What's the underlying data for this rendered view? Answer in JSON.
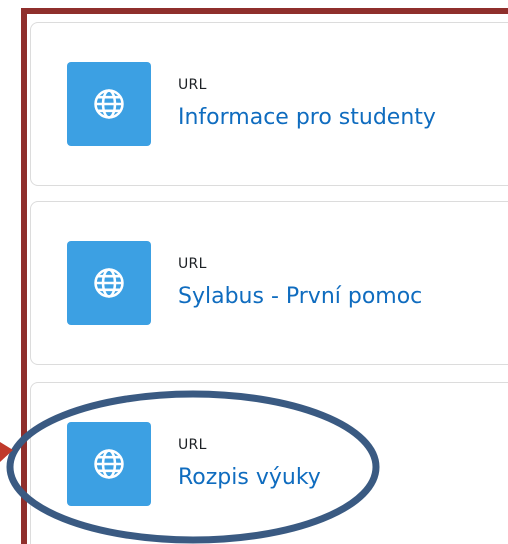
{
  "accent_colors": {
    "frame": "#8f2f2c",
    "icon_tile": "#3ca0e3",
    "link_text": "#0f6cbf",
    "annotation": "#3a5a82",
    "arrow": "#c0392b"
  },
  "activities": [
    {
      "type_label": "URL",
      "title": "Informace pro studenty",
      "icon": "globe-icon"
    },
    {
      "type_label": "URL",
      "title": "Sylabus - První pomoc",
      "icon": "globe-icon"
    },
    {
      "type_label": "URL",
      "title": "Rozpis výuky",
      "icon": "globe-icon"
    }
  ]
}
